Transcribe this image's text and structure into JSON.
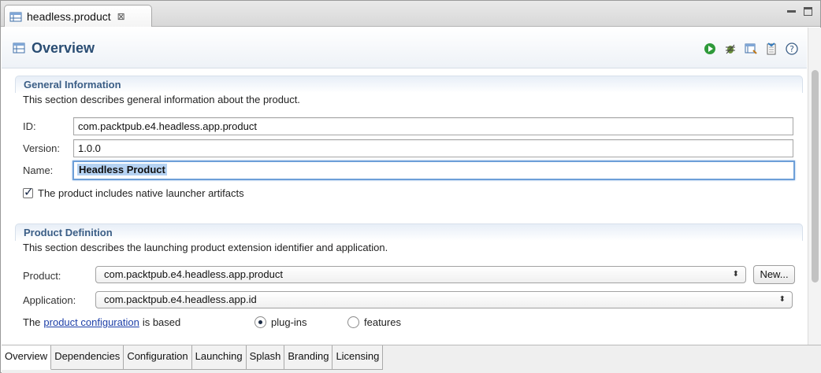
{
  "editor_tab": {
    "label": "headless.product",
    "close_glyph": "⊠"
  },
  "header": {
    "title": "Overview",
    "tools": [
      "run-icon",
      "debug-icon",
      "export-icon",
      "sync-icon",
      "help-icon"
    ]
  },
  "general": {
    "title": "General Information",
    "description": "This section describes general information about the product.",
    "id_label": "ID:",
    "id_value": "com.packtpub.e4.headless.app.product",
    "version_label": "Version:",
    "version_value": "1.0.0",
    "name_label": "Name:",
    "name_value": "Headless Product",
    "native_checkbox_label": "The product includes native launcher artifacts",
    "native_checked": true
  },
  "definition": {
    "title": "Product Definition",
    "description": "This section describes the launching product extension identifier and application.",
    "product_label": "Product:",
    "product_value": "com.packtpub.e4.headless.app.product",
    "new_button": "New...",
    "application_label": "Application:",
    "application_value": "com.packtpub.e4.headless.app.id",
    "config_prefix": "The",
    "config_link": "product configuration",
    "config_suffix": "is based",
    "radio_plugins": "plug-ins",
    "radio_features": "features",
    "selected": "plug-ins"
  },
  "page_tabs": [
    "Overview",
    "Dependencies",
    "Configuration",
    "Launching",
    "Splash",
    "Branding",
    "Licensing"
  ],
  "colors": {
    "section_title": "#3b5e86",
    "header_title": "#2a4d73",
    "link": "#1d3fa8",
    "focus": "#6d9fd8"
  }
}
